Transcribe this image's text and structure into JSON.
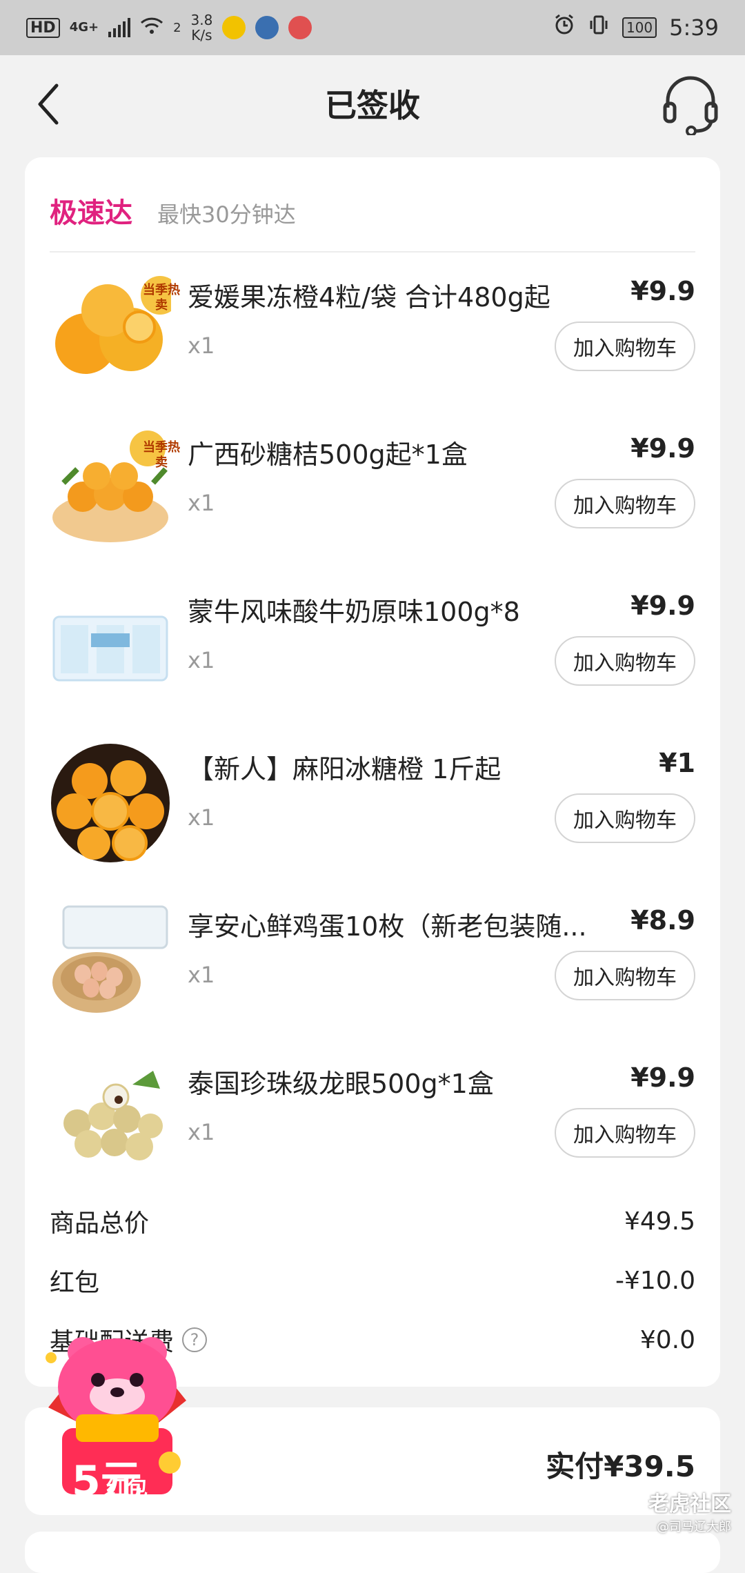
{
  "status_bar": {
    "hd": "HD",
    "network": "4G+",
    "wifi_level": "2",
    "speed_value": "3.8",
    "speed_unit": "K/s",
    "battery": "100",
    "time": "5:39"
  },
  "header": {
    "title": "已签收"
  },
  "delivery": {
    "brand": "极速达",
    "tagline": "最快30分钟达"
  },
  "items": [
    {
      "name": "爱媛果冻橙4粒/袋 合计480g起",
      "price": "¥9.9",
      "qty": "x1",
      "button": "加入购物车",
      "badge": "当季热卖"
    },
    {
      "name": "广西砂糖桔500g起*1盒",
      "price": "¥9.9",
      "qty": "x1",
      "button": "加入购物车",
      "badge": "当季热卖"
    },
    {
      "name": "蒙牛风味酸牛奶原味100g*8",
      "price": "¥9.9",
      "qty": "x1",
      "button": "加入购物车"
    },
    {
      "name": "【新人】麻阳冰糖橙 1斤起",
      "price": "¥1",
      "qty": "x1",
      "button": "加入购物车"
    },
    {
      "name": "享安心鲜鸡蛋10枚（新老包装随...",
      "price": "¥8.9",
      "qty": "x1",
      "button": "加入购物车"
    },
    {
      "name": "泰国珍珠级龙眼500g*1盒",
      "price": "¥9.9",
      "qty": "x1",
      "button": "加入购物车"
    }
  ],
  "summary": {
    "goods_total_label": "商品总价",
    "goods_total_value": "¥49.5",
    "red_packet_label": "红包",
    "red_packet_value": "-¥10.0",
    "delivery_fee_label": "基础配送费",
    "delivery_fee_value": "¥0.0",
    "help": "?"
  },
  "payment": {
    "total": "实付¥39.5"
  },
  "promo": {
    "amount": "5元",
    "label": "红包"
  },
  "watermark": {
    "main": "老虎社区",
    "sub": "@司马辽大郎"
  },
  "colors": {
    "accent": "#e0227f",
    "background": "#f2f2f2",
    "card": "#ffffff"
  }
}
